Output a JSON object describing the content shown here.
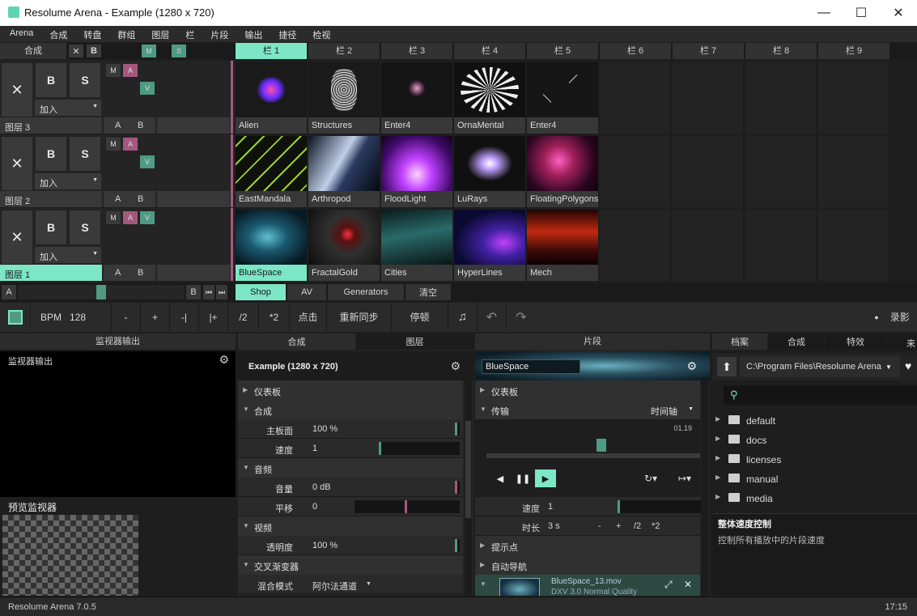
{
  "window": {
    "title": "Resolume Arena - Example (1280 x 720)",
    "min": "—",
    "max": "☐",
    "close": "✕"
  },
  "menu": [
    "Arena",
    "合成",
    "转盘",
    "群组",
    "图层",
    "栏",
    "片段",
    "输出",
    "捷径",
    "检视"
  ],
  "comp_row": {
    "label": "合成",
    "x": "✕",
    "b": "B",
    "m": "M",
    "s": "S"
  },
  "columns": [
    "栏 1",
    "栏 2",
    "栏 3",
    "栏 4",
    "栏 5",
    "栏 6",
    "栏 7",
    "栏 8",
    "栏 9"
  ],
  "layers": [
    {
      "name": "图层 3",
      "blend": "加入",
      "x": "✕",
      "b": "B",
      "s": "S",
      "m": "M",
      "a": "A",
      "v": "V",
      "ab_a": "A",
      "ab_b": "B",
      "clips": [
        "Alien",
        "Structures",
        "Enter4",
        "OrnaMental",
        "Enter4"
      ]
    },
    {
      "name": "图层 2",
      "blend": "加入",
      "x": "✕",
      "b": "B",
      "s": "S",
      "m": "M",
      "a": "A",
      "v": "V",
      "ab_a": "A",
      "ab_b": "B",
      "clips": [
        "EastMandala",
        "Arthropod",
        "FloodLight",
        "LuRays",
        "FloatingPolygons"
      ]
    },
    {
      "name": "图层 1",
      "blend": "加入",
      "x": "✕",
      "b": "B",
      "s": "S",
      "m": "M",
      "a": "A",
      "v": "V",
      "ab_a": "A",
      "ab_b": "B",
      "clips": [
        "BlueSpace",
        "FractalGold",
        "Cities",
        "HyperLines",
        "Mech"
      ]
    }
  ],
  "crossfader": {
    "a": "A",
    "b": "B",
    "prev": "⏮",
    "next": "⏭"
  },
  "deck_tabs": [
    "Shop",
    "AV",
    "Generators",
    "清空"
  ],
  "toolbar": {
    "bpm_label": "BPM",
    "bpm": "128",
    "minus": "-",
    "plus": "+",
    "nudge_l": "-|",
    "nudge_r": "|+",
    "half": "/2",
    "double": "*2",
    "tap": "点击",
    "resync": "重新同步",
    "pause": "停顿",
    "record": "录影",
    "record_dot": "●"
  },
  "monitor": {
    "tab": "监视器输出",
    "title": "监视器输出",
    "preview": "预览监视器"
  },
  "comp_panel": {
    "tabs": [
      "合成",
      "图层"
    ],
    "title": "Example (1280 x 720)",
    "sections": {
      "dashboard": "仪表板",
      "comp": "合成",
      "audio": "音频",
      "video": "视频",
      "xfade": "交叉渐变器"
    },
    "params": {
      "master_l": "主板面",
      "master_v": "100 %",
      "speed_l": "速度",
      "speed_v": "1",
      "vol_l": "音量",
      "vol_v": "0 dB",
      "pan_l": "平移",
      "pan_v": "0",
      "opacity_l": "透明度",
      "opacity_v": "100 %",
      "blend_l": "混合模式",
      "blend_v": "阿尔法通道"
    }
  },
  "clip_panel": {
    "tab": "片段",
    "name": "BlueSpace",
    "sections": {
      "dashboard": "仪表板",
      "transport": "传输",
      "cue": "提示点",
      "autopilot": "自动导航"
    },
    "timeline": "时间轴",
    "time": "01.19",
    "speed_l": "速度",
    "speed_v": "1",
    "dur_l": "时长",
    "dur_v": "3 s",
    "dur_minus": "-",
    "dur_plus": "+",
    "dur_half": "/2",
    "dur_double": "*2",
    "file_name": "BlueSpace_13.mov",
    "file_info": "DXV 3.0 Normal Quality"
  },
  "browser": {
    "tabs": [
      "档案",
      "合成",
      "特效",
      "来"
    ],
    "path": "C:\\Program Files\\Resolume Arena",
    "folders": [
      "default",
      "docs",
      "licenses",
      "manual",
      "media"
    ],
    "info_title": "整体速度控制",
    "info_text": "控制所有播放中的片段速度"
  },
  "status": {
    "version": "Resolume Arena 7.0.5",
    "time": "17:15"
  },
  "colors": {
    "accent": "#7de6c4",
    "pink": "#a4587f",
    "green": "#4f9a84"
  }
}
